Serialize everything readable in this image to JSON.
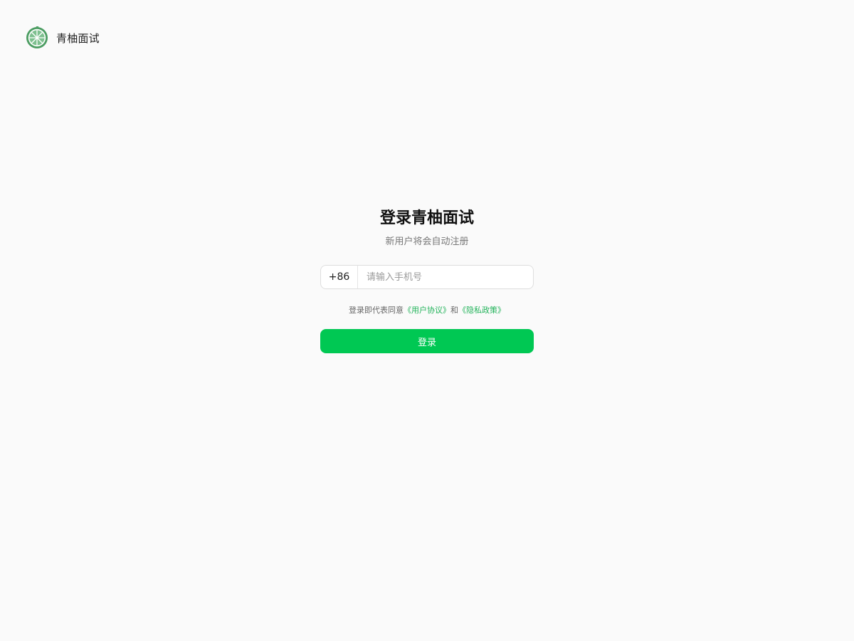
{
  "header": {
    "logo_icon": "lime-slice-icon",
    "brand_name": "青柚面试"
  },
  "login": {
    "title": "登录青柚面试",
    "subtitle": "新用户将会自动注册",
    "country_code": "+86",
    "phone_value": "",
    "phone_placeholder": "请输入手机号",
    "agreement": {
      "prefix": "登录即代表同意",
      "user_agreement": "《用户协议》",
      "conjunction": "和",
      "privacy_policy": "《隐私政策》"
    },
    "submit_label": "登录"
  },
  "colors": {
    "background": "#fafafa",
    "accent": "#00c853",
    "link": "#22b35a",
    "logo_green": "#4c9d62"
  }
}
